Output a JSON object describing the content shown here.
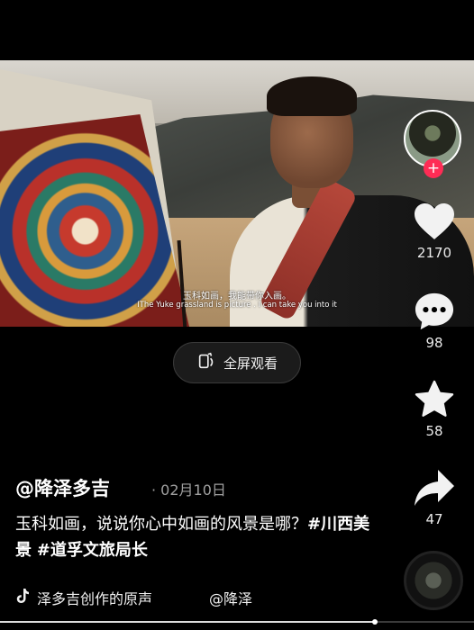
{
  "video": {
    "subtitle_cn": "玉科如画，我能带你入画。",
    "subtitle_en": "IThe Yuke grassland is picture . I can take you into it"
  },
  "fullscreen": {
    "label": "全屏观看",
    "icon": "fullscreen-icon"
  },
  "rail": {
    "follow_icon": "plus-icon",
    "like": {
      "count": "2170",
      "icon": "heart-icon"
    },
    "comment": {
      "count": "98",
      "icon": "comment-icon"
    },
    "favorite": {
      "count": "58",
      "icon": "star-icon"
    },
    "share": {
      "count": "47",
      "icon": "share-icon"
    }
  },
  "post": {
    "author": "@降泽多吉",
    "date": "· 02月10日",
    "text": "玉科如画，说说你心中如画的风景是哪？",
    "tags": [
      "#川西美景",
      "#道孚文旅局长"
    ]
  },
  "music": {
    "icon": "tiktok-note-icon",
    "title": "泽多吉创作的原声",
    "mention": "@降泽"
  },
  "progress": {
    "value": 0.79
  },
  "colors": {
    "accent": "#fe2c55",
    "background": "#000000",
    "text": "#ffffff",
    "muted": "#a0a0a0"
  }
}
